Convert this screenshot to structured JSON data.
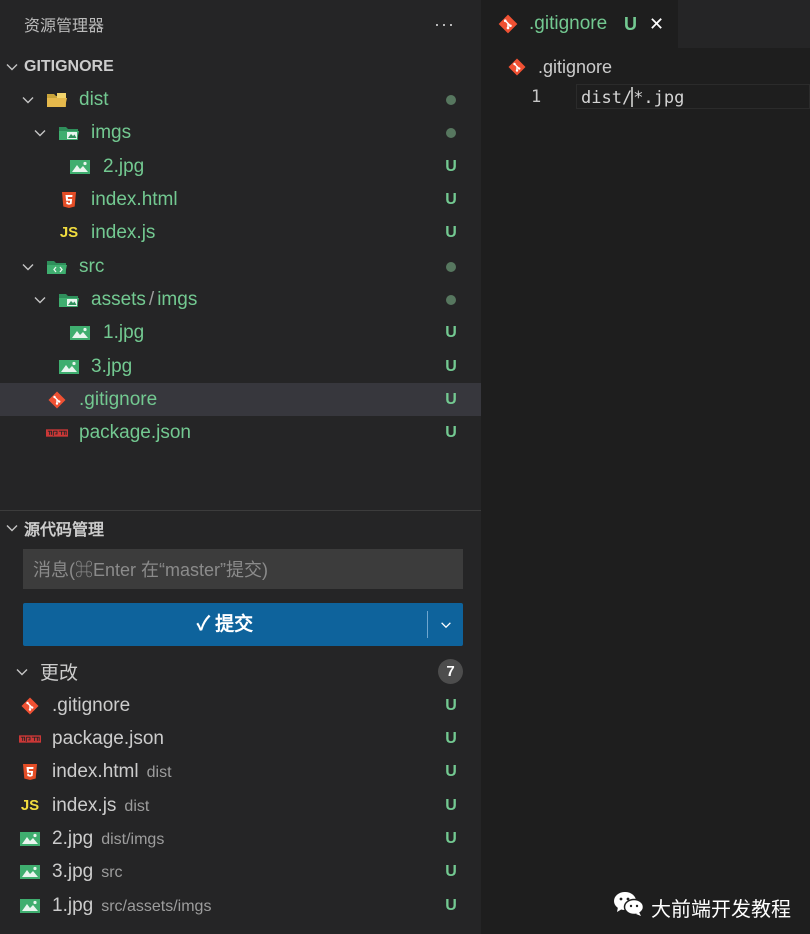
{
  "explorer": {
    "title": "资源管理器",
    "more": "···",
    "root_label": "GITIGNORE",
    "tree": [
      {
        "label": "dist",
        "status": "dot"
      },
      {
        "label": "imgs",
        "status": "dot"
      },
      {
        "label": "2.jpg",
        "status": "U"
      },
      {
        "label": "index.html",
        "status": "U"
      },
      {
        "label": "index.js",
        "status": "U"
      },
      {
        "label": "src",
        "status": "dot"
      },
      {
        "label": "assets",
        "label2": "imgs",
        "status": "dot"
      },
      {
        "label": "1.jpg",
        "status": "U"
      },
      {
        "label": "3.jpg",
        "status": "U"
      },
      {
        "label": ".gitignore",
        "status": "U"
      },
      {
        "label": "package.json",
        "status": "U"
      }
    ]
  },
  "scm": {
    "title": "源代码管理",
    "message_placeholder": "消息(⌘Enter 在“master”提交)",
    "commit_label": "✓ 提交",
    "changes_label": "更改",
    "changes_count": "7",
    "changes": [
      {
        "name": ".gitignore",
        "path": "",
        "status": "U"
      },
      {
        "name": "package.json",
        "path": "",
        "status": "U"
      },
      {
        "name": "index.html",
        "path": "dist",
        "status": "U"
      },
      {
        "name": "index.js",
        "path": "dist",
        "status": "U"
      },
      {
        "name": "2.jpg",
        "path": "dist/imgs",
        "status": "U"
      },
      {
        "name": "3.jpg",
        "path": "src",
        "status": "U"
      },
      {
        "name": "1.jpg",
        "path": "src/assets/imgs",
        "status": "U"
      }
    ]
  },
  "editor": {
    "tab_label": ".gitignore",
    "tab_status": "U",
    "tab_close": "✕",
    "breadcrumb": ".gitignore",
    "line_number": "1",
    "line_before_cursor": "dist/",
    "line_after_cursor": "*.jpg"
  },
  "watermark": "大前端开发教程",
  "colors": {
    "sidebar_bg": "#252526",
    "editor_bg": "#1e1e1e",
    "untracked": "#73c991",
    "commit_button": "#0e639c",
    "selection": "#37373d",
    "git_icon": "#f05133"
  },
  "icons": {
    "folder_dist": "folder-dist-icon",
    "folder_imgs": "folder-images-icon",
    "folder_src": "folder-src-icon",
    "image": "image-file-icon",
    "html": "html5-icon",
    "js": "js-icon",
    "git": "git-icon",
    "npm": "npm-icon",
    "wechat": "wechat-icon"
  }
}
